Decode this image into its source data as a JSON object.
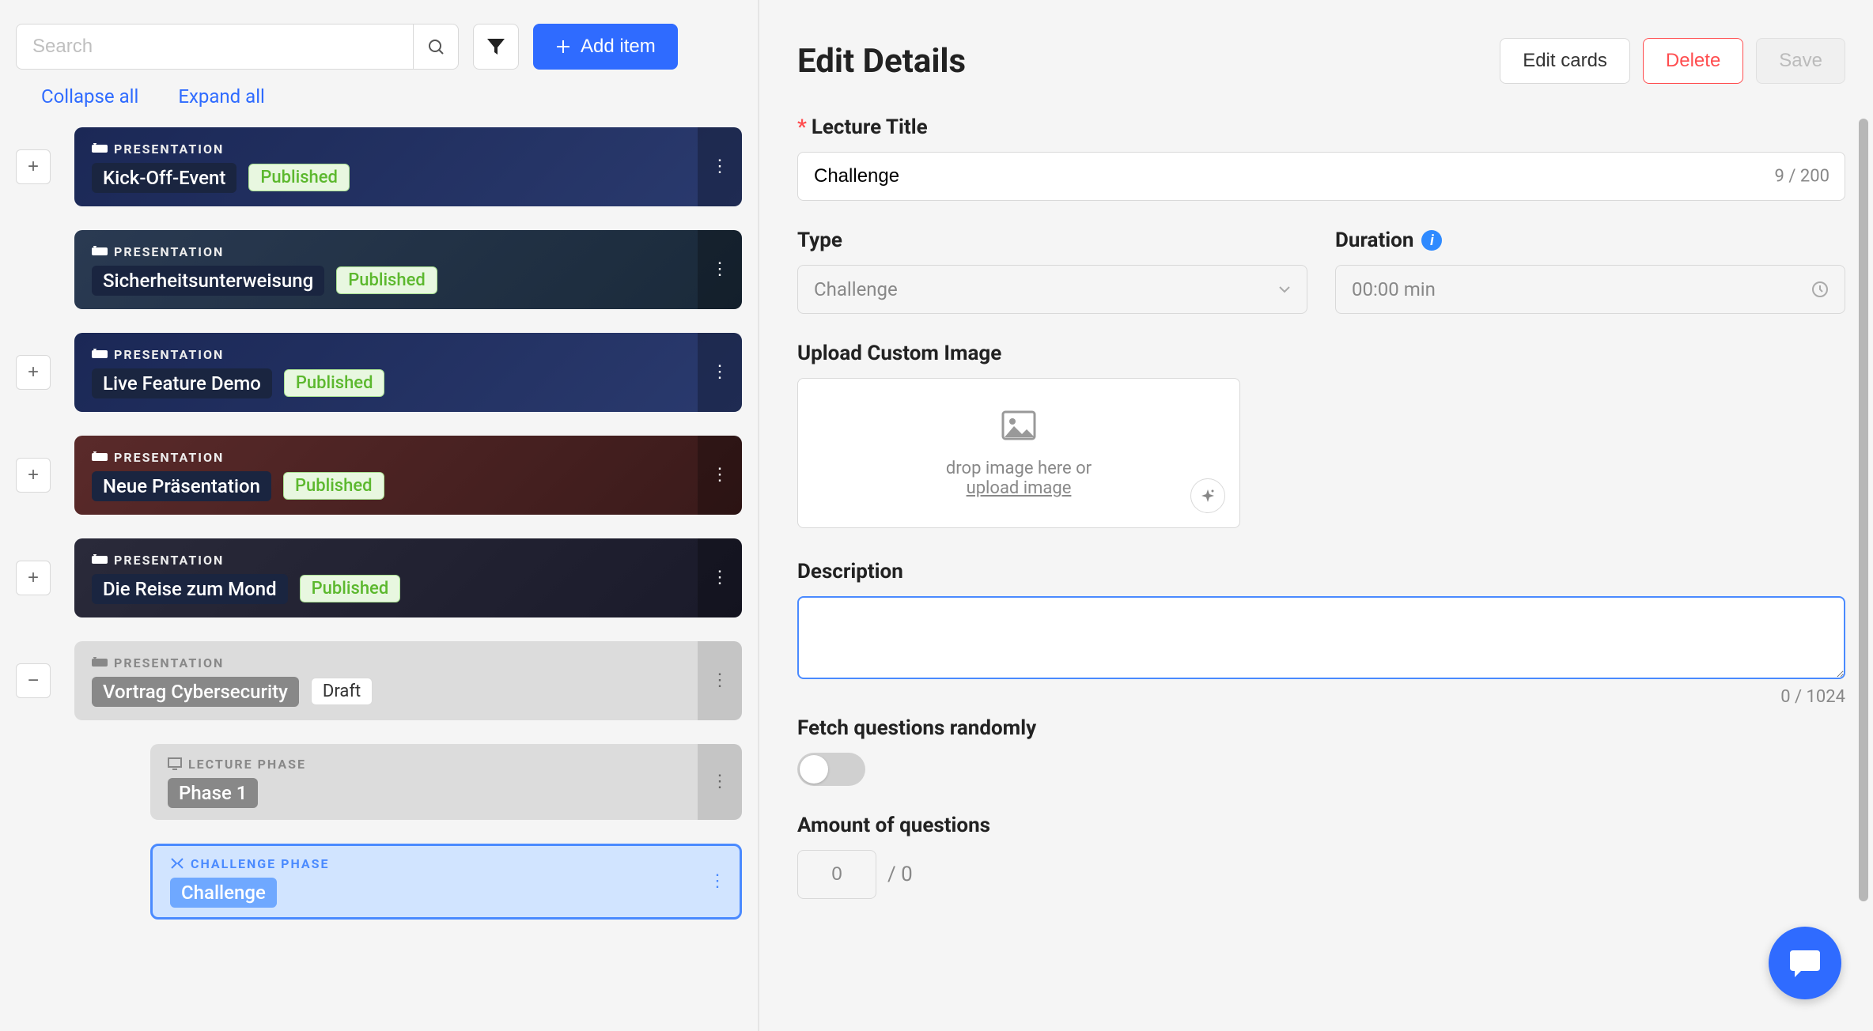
{
  "toolbar": {
    "search_placeholder": "Search",
    "add_item_label": "Add item"
  },
  "expand": {
    "collapse_label": "Collapse all",
    "expand_label": "Expand all"
  },
  "items": [
    {
      "type_label": "PRESENTATION",
      "title": "Kick-Off-Event",
      "status": "Published",
      "tree": "plus"
    },
    {
      "type_label": "PRESENTATION",
      "title": "Sicherheitsunterweisung",
      "status": "Published",
      "tree": ""
    },
    {
      "type_label": "PRESENTATION",
      "title": "Live Feature Demo",
      "status": "Published",
      "tree": "plus"
    },
    {
      "type_label": "PRESENTATION",
      "title": "Neue Präsentation",
      "status": "Published",
      "tree": "plus"
    },
    {
      "type_label": "PRESENTATION",
      "title": "Die Reise zum Mond",
      "status": "Published",
      "tree": "plus"
    },
    {
      "type_label": "PRESENTATION",
      "title": "Vortrag Cybersecurity",
      "status": "Draft",
      "tree": "minus"
    }
  ],
  "nested": {
    "lecture_type": "LECTURE PHASE",
    "lecture_title": "Phase 1",
    "challenge_type": "CHALLENGE PHASE",
    "challenge_title": "Challenge"
  },
  "panel": {
    "title": "Edit Details",
    "edit_cards_label": "Edit cards",
    "delete_label": "Delete",
    "save_label": "Save",
    "lecture_title_label": "Lecture Title",
    "lecture_title_value": "Challenge",
    "lecture_title_count": "9 / 200",
    "type_label": "Type",
    "type_value": "Challenge",
    "duration_label": "Duration",
    "duration_placeholder": "00:00 min",
    "upload_label": "Upload Custom Image",
    "upload_text1": "drop image here or",
    "upload_text2": "upload image",
    "description_label": "Description",
    "description_count": "0 / 1024",
    "fetch_label": "Fetch questions randomly",
    "amount_label": "Amount of questions",
    "amount_value": "0",
    "amount_max": "/ 0"
  }
}
